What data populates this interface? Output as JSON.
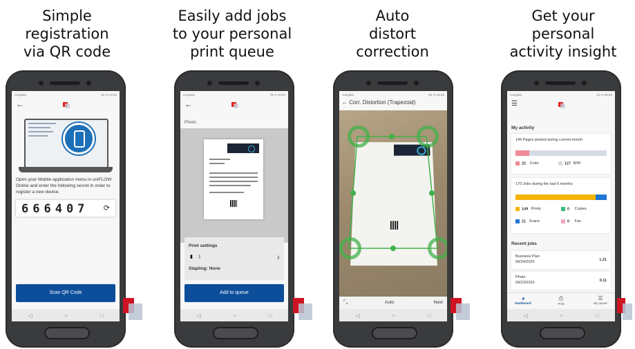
{
  "captions": [
    "Simple\nregistration\nvia QR code",
    "Easily add jobs\nto your personal\nprint queue",
    "Auto\ndistort\ncorrection",
    "Get your\npersonal\nactivity  insight"
  ],
  "status": {
    "p1_left": "congstar",
    "p1_right": "81 % 14:50",
    "p2_left": "congstar",
    "p2_right": "79 % 15:04",
    "p3_left": "congstar",
    "p3_right": "83 % 15:02",
    "p4_left": "congstar",
    "p4_right": "31 % 09:45"
  },
  "phone1": {
    "instruction": "Open your Mobile application menu in uniFLOW Online and enter the following secret in order to register a new device.",
    "code": "666407",
    "scan_button": "Scan QR Code"
  },
  "phone2": {
    "title": "Photo",
    "print_settings": "Print settings",
    "copies": "1",
    "stapling": "Stapling: None",
    "add_button": "Add to queue"
  },
  "phone3": {
    "title": "Corr. Distortion (Trapezoid)",
    "auto": "Auto",
    "next": "Next"
  },
  "phone4": {
    "section": "My activity",
    "pages_count": "149",
    "pages_label": "Pages printed during current month",
    "color_count": "22",
    "color_label": "Color",
    "bw_count": "127",
    "bw_label": "B/W",
    "jobs_count": "170",
    "jobs_label": "Jobs during the last 6 months",
    "prints_count": "149",
    "prints_label": "Prints",
    "copies_count": "0",
    "copies_label": "Copies",
    "scans_count": "21",
    "scans_label": "Scans",
    "fax_count": "0",
    "fax_label": "Fax",
    "recent": "Recent jobs",
    "job1_name": "Business Plan",
    "job1_date": "09/24/2020",
    "job1_cost": "1.21",
    "job2_name": "Photo",
    "job2_date": "09/23/2020",
    "job2_cost": "0.11",
    "tab_dashboard": "Dashboard",
    "tab_print": "Print",
    "tab_queue": "My queue"
  },
  "colors": {
    "accent_blue": "#0d4e9b",
    "brand_red": "#e0201f",
    "corner_green": "#41b14b",
    "color_bar": "#f08a96",
    "prints_bar": "#f4b400",
    "scans_bar": "#1e77d3"
  },
  "levels": {
    "color_fraction": 0.148,
    "prints_fraction": 0.876
  }
}
